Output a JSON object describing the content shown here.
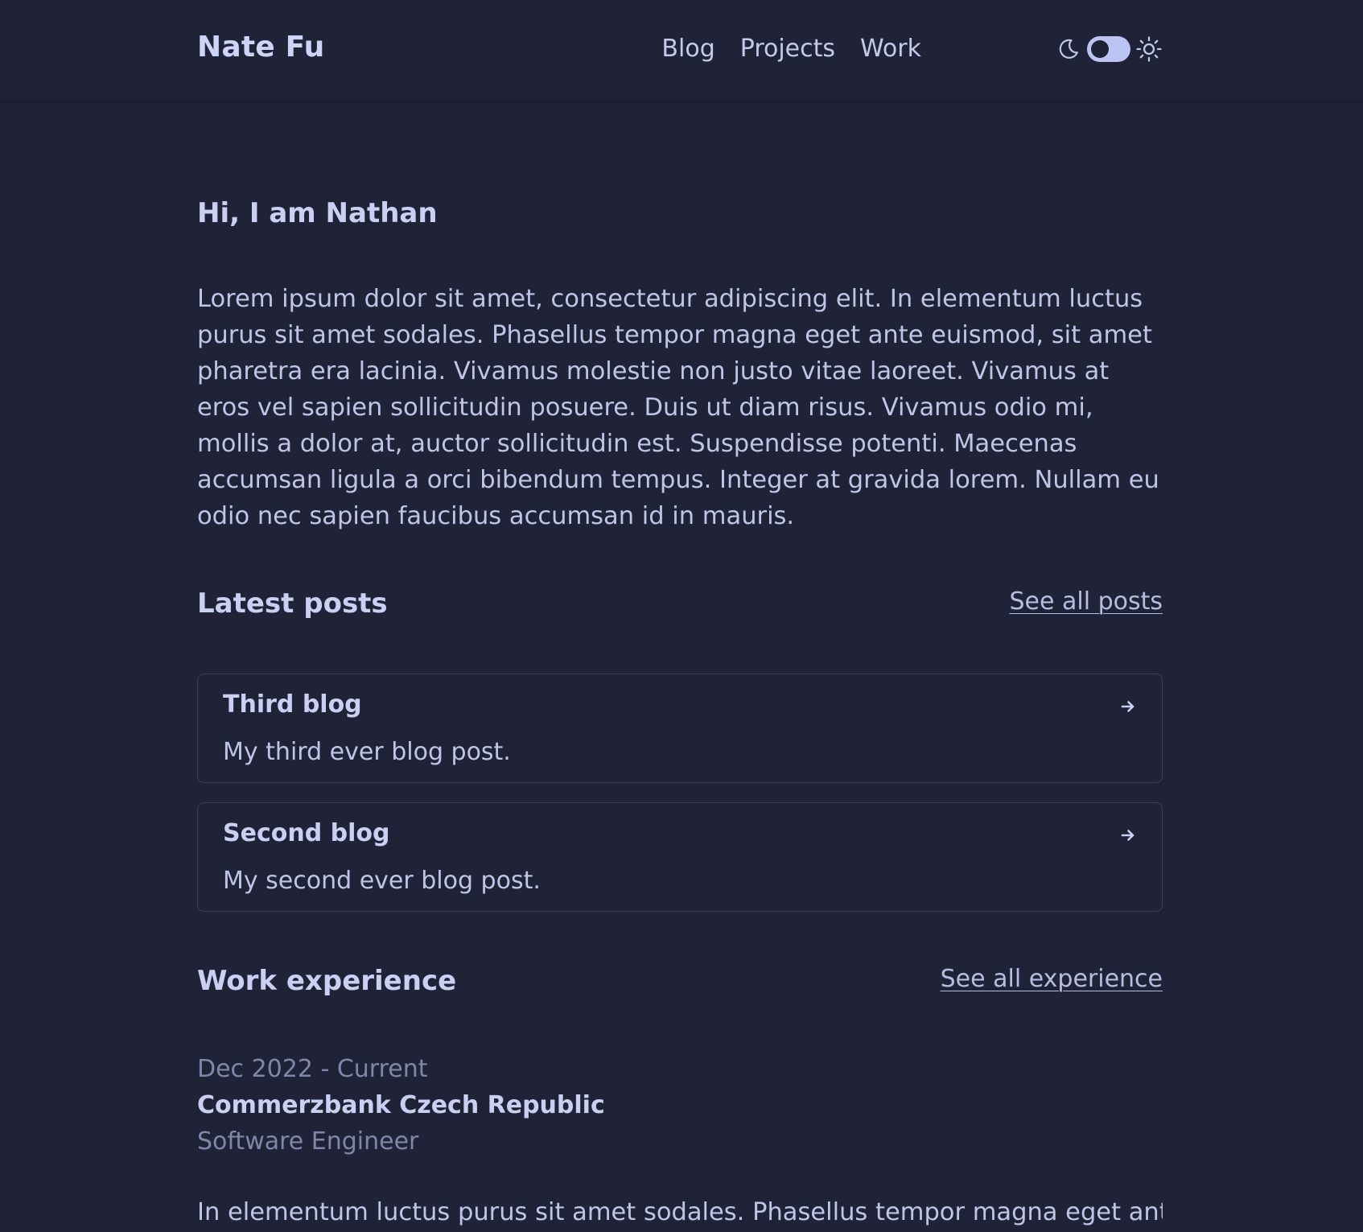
{
  "header": {
    "brand": "Nate Fu",
    "nav": [
      {
        "label": "Blog"
      },
      {
        "label": "Projects"
      },
      {
        "label": "Work"
      }
    ],
    "theme_toggle": {
      "left_icon": "moon-icon",
      "right_icon": "sun-icon",
      "state": "dark"
    }
  },
  "intro": {
    "greeting": "Hi, I am Nathan",
    "text": "Lorem ipsum dolor sit amet, consectetur adipiscing elit. In elementum luctus purus sit amet sodales. Phasellus tempor magna eget ante euismod, sit amet pharetra era lacinia. Vivamus molestie non justo vitae laoreet. Vivamus at eros vel sapien sollicitudin posuere. Duis ut diam risus. Vivamus odio mi, mollis a dolor at, auctor sollicitudin est. Suspendisse potenti. Maecenas accumsan ligula a orci bibendum tempus. Integer at gravida lorem. Nullam eu odio nec sapien faucibus accumsan id in mauris."
  },
  "posts": {
    "title": "Latest posts",
    "see_all": "See all posts",
    "items": [
      {
        "title": "Third blog",
        "description": "My third ever blog post."
      },
      {
        "title": "Second blog",
        "description": "My second ever blog post."
      }
    ]
  },
  "work": {
    "title": "Work experience",
    "see_all": "See all experience",
    "items": [
      {
        "dates": "Dec 2022 - Current",
        "company": "Commerzbank Czech Republic",
        "role": "Software Engineer",
        "description": "In elementum luctus purus sit amet sodales. Phasellus tempor magna eget ante"
      }
    ]
  },
  "colors": {
    "background": "#202338",
    "text": "#c9d0f2",
    "muted": "#7f86a8",
    "toggle": "#bcc4f3"
  }
}
